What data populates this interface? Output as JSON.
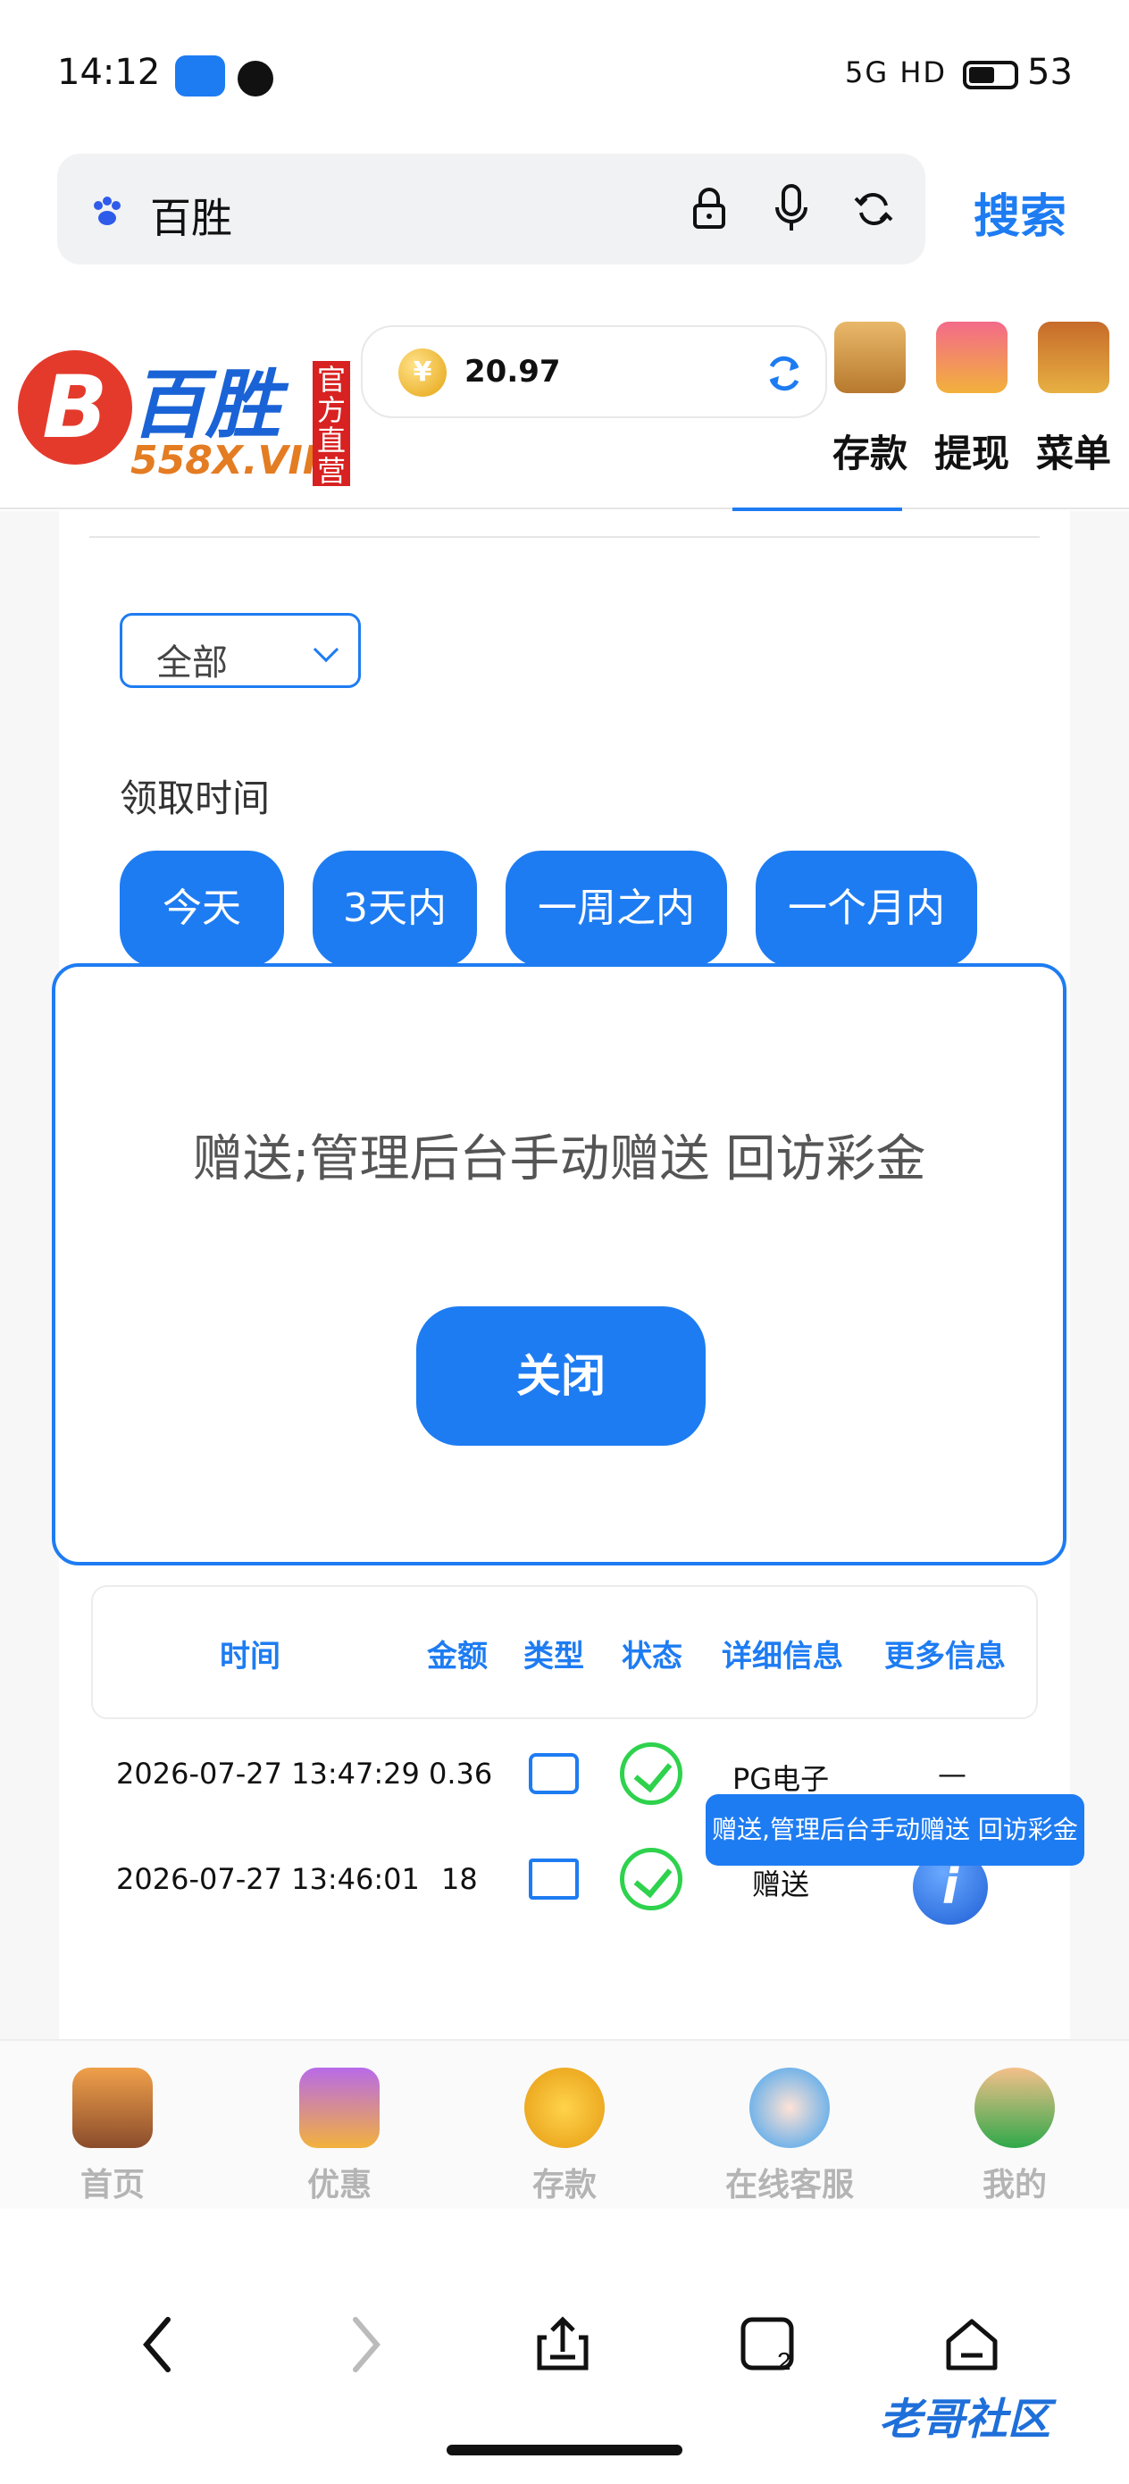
{
  "status_bar": {
    "time": "14:12",
    "signal": "5G HD",
    "battery": "53"
  },
  "browser": {
    "query": "百胜",
    "search_label": "搜索"
  },
  "site": {
    "logo_title": "百胜",
    "logo_sub": "558X.VIP",
    "logo_tag": "官方直营",
    "balance": "20.97",
    "actions": [
      "存款",
      "提现",
      "菜单"
    ]
  },
  "filter": {
    "selected": "全部",
    "time_label": "领取时间",
    "ranges": [
      "今天",
      "3天内",
      "一周之内",
      "一个月内"
    ]
  },
  "modal": {
    "message": "赠送;管理后台手动赠送 回访彩金",
    "close_label": "关闭"
  },
  "table": {
    "headers": [
      "时间",
      "金额",
      "类型",
      "状态",
      "详细信息",
      "更多信息"
    ],
    "rows": [
      {
        "time": "2026-07-27 13:47:29",
        "amount": "0.36",
        "type_icon": "card-icon",
        "status_icon": "check-icon",
        "detail": "PG电子",
        "more": "—"
      },
      {
        "time": "2026-07-27 13:46:01",
        "amount": "18",
        "type_icon": "calendar-star-icon",
        "status_icon": "check-icon",
        "detail": "赠送",
        "more": "i"
      }
    ],
    "tooltip": "赠送,管理后台手动赠送 回访彩金"
  },
  "tabbar": {
    "items": [
      "首页",
      "优惠",
      "存款",
      "在线客服",
      "我的"
    ]
  },
  "watermark": "老哥社区",
  "colors": {
    "accent": "#1e7cf2",
    "success": "#2ed24c",
    "brand_red": "#d82121"
  }
}
